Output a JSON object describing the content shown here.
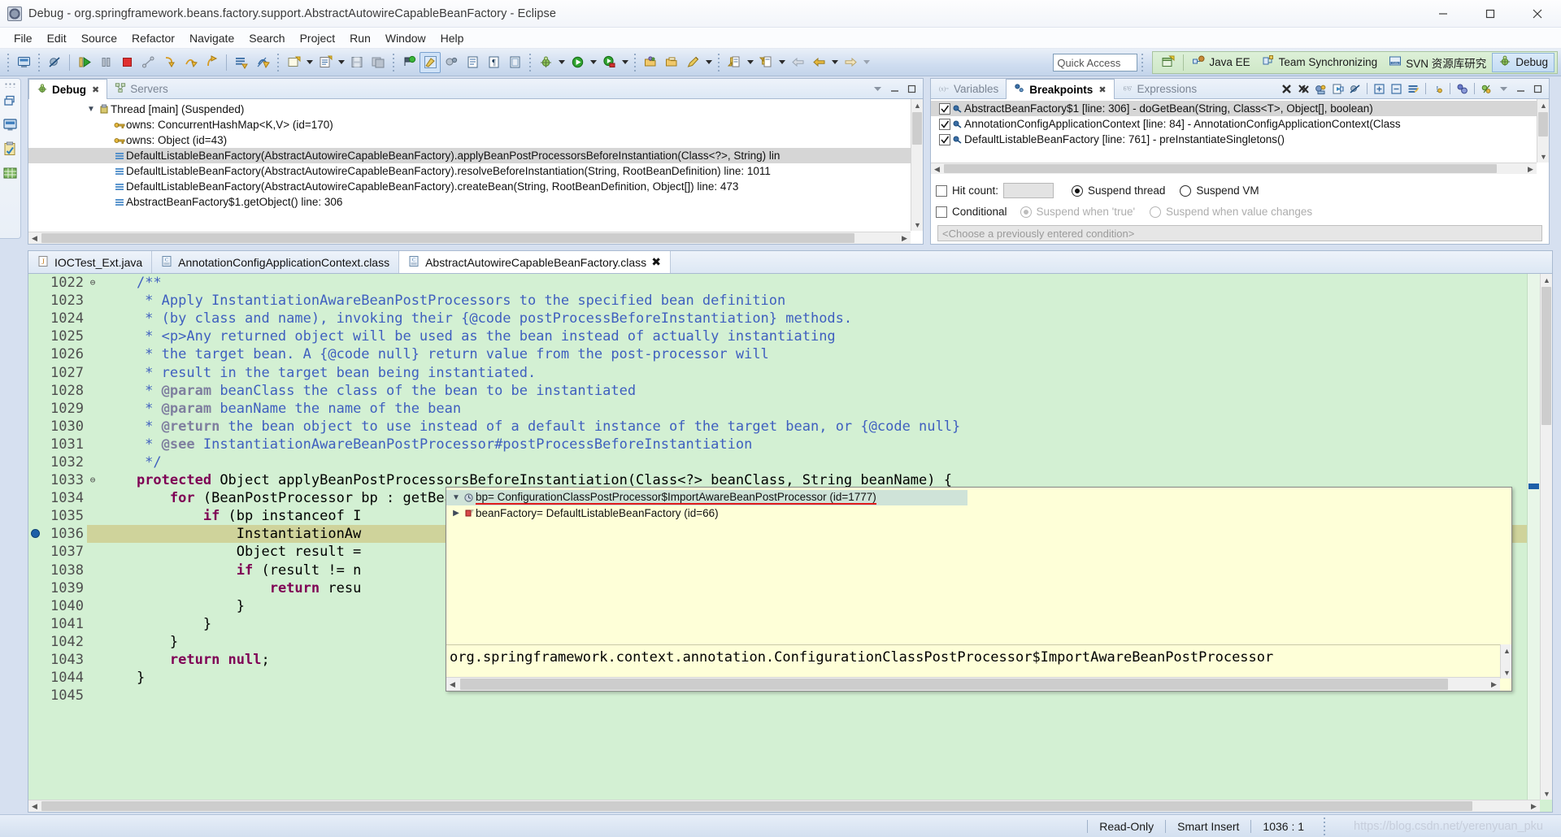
{
  "window": {
    "title": "Debug - org.springframework.beans.factory.support.AbstractAutowireCapableBeanFactory - Eclipse",
    "minimize_label": "Minimize",
    "maximize_label": "Maximize",
    "close_label": "Close"
  },
  "menubar": {
    "items": [
      "File",
      "Edit",
      "Source",
      "Refactor",
      "Navigate",
      "Search",
      "Project",
      "Run",
      "Window",
      "Help"
    ]
  },
  "toolbar": {
    "quick_access_placeholder": "Quick Access",
    "icons": [
      "new-window-icon",
      "skip-breakpoints-icon",
      "resume-icon",
      "suspend-icon",
      "terminate-icon",
      "disconnect-icon",
      "step-into-icon",
      "step-over-icon",
      "step-return-icon",
      "drop-to-frame-icon",
      "use-step-filters-icon",
      "new-wizard-icon",
      "new-java-class-icon",
      "save-icon",
      "save-all-icon",
      "debug-last-icon",
      "skip-all-breakpoints-icon",
      "toggle-mark-occurrences-icon",
      "link-with-editor-icon",
      "show-whitespace-icon",
      "show-annotations-icon",
      "debug-icon",
      "run-icon",
      "run-coverage-icon",
      "open-type-icon",
      "open-task-icon",
      "pencil-icon",
      "previous-annotation-icon",
      "next-annotation-icon",
      "back-icon",
      "forward-icon"
    ]
  },
  "perspectives": {
    "open_perspective_label": "Open Perspective",
    "items": [
      {
        "label": "Java EE",
        "icon": "java-ee-icon",
        "active": false
      },
      {
        "label": "Team Synchronizing",
        "icon": "team-sync-icon",
        "active": false
      },
      {
        "label": "SVN 资源库研究",
        "icon": "svn-icon",
        "active": false
      },
      {
        "label": "Debug",
        "icon": "debug-perspective-icon",
        "active": true
      }
    ]
  },
  "rail": {
    "items": [
      "restore-icon",
      "debug-view-icon",
      "breakpoints-view-icon",
      "variables-grid-icon"
    ]
  },
  "debug_view": {
    "tabs": [
      {
        "label": "Debug",
        "icon": "bug-icon",
        "active": true,
        "closeable": true
      },
      {
        "label": "Servers",
        "icon": "servers-icon",
        "active": false,
        "closeable": false
      }
    ],
    "tree": [
      {
        "indent": 1,
        "twisty": "v",
        "icon": "thread-icon",
        "label": "Thread [main] (Suspended)",
        "selected": false
      },
      {
        "indent": 2,
        "twisty": "",
        "icon": "monitor-key-icon",
        "label": "owns: ConcurrentHashMap<K,V>  (id=170)",
        "selected": false
      },
      {
        "indent": 2,
        "twisty": "",
        "icon": "monitor-key-icon",
        "label": "owns: Object  (id=43)",
        "selected": false
      },
      {
        "indent": 2,
        "twisty": "",
        "icon": "stack-frame-icon",
        "label": "DefaultListableBeanFactory(AbstractAutowireCapableBeanFactory).applyBeanPostProcessorsBeforeInstantiation(Class<?>, String) lin",
        "selected": true
      },
      {
        "indent": 2,
        "twisty": "",
        "icon": "stack-frame-icon",
        "label": "DefaultListableBeanFactory(AbstractAutowireCapableBeanFactory).resolveBeforeInstantiation(String, RootBeanDefinition) line: 1011",
        "selected": false
      },
      {
        "indent": 2,
        "twisty": "",
        "icon": "stack-frame-icon",
        "label": "DefaultListableBeanFactory(AbstractAutowireCapableBeanFactory).createBean(String, RootBeanDefinition, Object[]) line: 473",
        "selected": false
      },
      {
        "indent": 2,
        "twisty": "",
        "icon": "stack-frame-icon",
        "label": "AbstractBeanFactory$1.getObject() line: 306",
        "selected": false
      }
    ]
  },
  "breakpoints_view": {
    "tabs": [
      {
        "label": "Variables",
        "icon": "variables-icon",
        "active": false,
        "closeable": false
      },
      {
        "label": "Breakpoints",
        "icon": "breakpoints-icon",
        "active": true,
        "closeable": true
      },
      {
        "label": "Expressions",
        "icon": "expressions-icon",
        "active": false,
        "closeable": false
      }
    ],
    "toolbar_icons": [
      "remove-breakpoint-icon",
      "remove-all-breakpoints-icon",
      "link-with-debug-view-icon",
      "goto-file-icon",
      "skip-all-breakpoints-icon",
      "expand-all-icon",
      "collapse-all-icon",
      "working-sets-icon",
      "hit-count-icon",
      "group-by-icon",
      "add-java-exception-icon",
      "view-menu-icon",
      "minimize-icon",
      "maximize-icon"
    ],
    "rows": [
      {
        "checked": true,
        "label": "AbstractBeanFactory$1 [line: 306] - doGetBean(String, Class<T>, Object[], boolean)",
        "selected": true
      },
      {
        "checked": true,
        "label": "AnnotationConfigApplicationContext [line: 84] - AnnotationConfigApplicationContext(Class",
        "selected": false
      },
      {
        "checked": true,
        "label": "DefaultListableBeanFactory [line: 761] - preInstantiateSingletons()",
        "selected": false
      }
    ],
    "properties": {
      "hit_count_label": "Hit count:",
      "hit_count_value": "",
      "suspend_thread_label": "Suspend thread",
      "suspend_vm_label": "Suspend VM",
      "suspend_thread_selected": true,
      "conditional_label": "Conditional",
      "suspend_when_true_label": "Suspend when 'true'",
      "suspend_when_changes_label": "Suspend when value changes",
      "condition_combo_text": "<Choose a previously entered condition>"
    }
  },
  "editor": {
    "tabs": [
      {
        "label": "IOCTest_Ext.java",
        "icon": "java-file-icon",
        "active": false,
        "closeable": false
      },
      {
        "label": "AnnotationConfigApplicationContext.class",
        "icon": "class-file-icon",
        "active": false,
        "closeable": false
      },
      {
        "label": "AbstractAutowireCapableBeanFactory.class",
        "icon": "class-file-icon",
        "active": true,
        "closeable": true
      }
    ],
    "lines": [
      {
        "num": "1022",
        "fold": "⊖",
        "bp": false,
        "hl": false,
        "segs": [
          {
            "t": "    ",
            "c": "plain"
          },
          {
            "t": "/**",
            "c": "cm"
          }
        ]
      },
      {
        "num": "1023",
        "fold": "",
        "bp": false,
        "hl": false,
        "segs": [
          {
            "t": "     * Apply InstantiationAwareBeanPostProcessors to the specified bean definition",
            "c": "cm"
          }
        ]
      },
      {
        "num": "1024",
        "fold": "",
        "bp": false,
        "hl": false,
        "segs": [
          {
            "t": "     * (by class and name), invoking their {@code postProcessBeforeInstantiation} methods.",
            "c": "cm"
          }
        ]
      },
      {
        "num": "1025",
        "fold": "",
        "bp": false,
        "hl": false,
        "segs": [
          {
            "t": "     * <p>Any returned object will be used as the bean instead of actually instantiating",
            "c": "cm"
          }
        ]
      },
      {
        "num": "1026",
        "fold": "",
        "bp": false,
        "hl": false,
        "segs": [
          {
            "t": "     * the target bean. A {@code null} return value from the post-processor will",
            "c": "cm"
          }
        ]
      },
      {
        "num": "1027",
        "fold": "",
        "bp": false,
        "hl": false,
        "segs": [
          {
            "t": "     * result in the target bean being instantiated.",
            "c": "cm"
          }
        ]
      },
      {
        "num": "1028",
        "fold": "",
        "bp": false,
        "hl": false,
        "segs": [
          {
            "t": "     * ",
            "c": "cm"
          },
          {
            "t": "@param",
            "c": "cmtag"
          },
          {
            "t": " beanClass the class of the bean to be instantiated",
            "c": "cm"
          }
        ]
      },
      {
        "num": "1029",
        "fold": "",
        "bp": false,
        "hl": false,
        "segs": [
          {
            "t": "     * ",
            "c": "cm"
          },
          {
            "t": "@param",
            "c": "cmtag"
          },
          {
            "t": " beanName the name of the bean",
            "c": "cm"
          }
        ]
      },
      {
        "num": "1030",
        "fold": "",
        "bp": false,
        "hl": false,
        "segs": [
          {
            "t": "     * ",
            "c": "cm"
          },
          {
            "t": "@return",
            "c": "cmtag"
          },
          {
            "t": " the bean object to use instead of a default instance of the target bean, or {@code null}",
            "c": "cm"
          }
        ]
      },
      {
        "num": "1031",
        "fold": "",
        "bp": false,
        "hl": false,
        "segs": [
          {
            "t": "     * ",
            "c": "cm"
          },
          {
            "t": "@see",
            "c": "cmtag"
          },
          {
            "t": " InstantiationAwareBeanPostProcessor#postProcessBeforeInstantiation",
            "c": "cm"
          }
        ]
      },
      {
        "num": "1032",
        "fold": "",
        "bp": false,
        "hl": false,
        "segs": [
          {
            "t": "     */",
            "c": "cm"
          }
        ]
      },
      {
        "num": "1033",
        "fold": "⊖",
        "bp": false,
        "hl": false,
        "segs": [
          {
            "t": "    ",
            "c": "plain"
          },
          {
            "t": "protected",
            "c": "kw"
          },
          {
            "t": " Object applyBeanPostProcessorsBeforeInstantiation(Class<?> beanClass, String beanName) {",
            "c": "plain"
          }
        ]
      },
      {
        "num": "1034",
        "fold": "",
        "bp": false,
        "hl": false,
        "segs": [
          {
            "t": "        ",
            "c": "plain"
          },
          {
            "t": "for",
            "c": "kw"
          },
          {
            "t": " (BeanPostProcessor bp : getBeanPostProcessors()) {",
            "c": "plain"
          }
        ]
      },
      {
        "num": "1035",
        "fold": "",
        "bp": false,
        "hl": false,
        "segs": [
          {
            "t": "            ",
            "c": "plain"
          },
          {
            "t": "if",
            "c": "kw"
          },
          {
            "t": " (bp instanceof I",
            "c": "plain"
          }
        ]
      },
      {
        "num": "1036",
        "fold": "",
        "bp": true,
        "hl": true,
        "segs": [
          {
            "t": "                InstantiationAw",
            "c": "plain"
          }
        ]
      },
      {
        "num": "1037",
        "fold": "",
        "bp": false,
        "hl": false,
        "segs": [
          {
            "t": "                Object result =",
            "c": "plain"
          }
        ]
      },
      {
        "num": "1038",
        "fold": "",
        "bp": false,
        "hl": false,
        "segs": [
          {
            "t": "                ",
            "c": "plain"
          },
          {
            "t": "if",
            "c": "kw"
          },
          {
            "t": " (result != n",
            "c": "plain"
          }
        ]
      },
      {
        "num": "1039",
        "fold": "",
        "bp": false,
        "hl": false,
        "segs": [
          {
            "t": "                    ",
            "c": "plain"
          },
          {
            "t": "return",
            "c": "kw"
          },
          {
            "t": " resu",
            "c": "plain"
          }
        ]
      },
      {
        "num": "1040",
        "fold": "",
        "bp": false,
        "hl": false,
        "segs": [
          {
            "t": "                }",
            "c": "plain"
          }
        ]
      },
      {
        "num": "1041",
        "fold": "",
        "bp": false,
        "hl": false,
        "segs": [
          {
            "t": "            }",
            "c": "plain"
          }
        ]
      },
      {
        "num": "1042",
        "fold": "",
        "bp": false,
        "hl": false,
        "segs": [
          {
            "t": "        }",
            "c": "plain"
          }
        ]
      },
      {
        "num": "1043",
        "fold": "",
        "bp": false,
        "hl": false,
        "segs": [
          {
            "t": "        ",
            "c": "plain"
          },
          {
            "t": "return null",
            "c": "kw"
          },
          {
            "t": ";",
            "c": "plain"
          }
        ]
      },
      {
        "num": "1044",
        "fold": "",
        "bp": false,
        "hl": false,
        "segs": [
          {
            "t": "    }",
            "c": "plain"
          }
        ]
      },
      {
        "num": "1045",
        "fold": "",
        "bp": false,
        "hl": false,
        "segs": [
          {
            "t": "",
            "c": "plain"
          }
        ]
      }
    ]
  },
  "popup": {
    "rows": [
      {
        "twisty": "v",
        "icon": "local-variable-icon",
        "label": "bp= ConfigurationClassPostProcessor$ImportAwareBeanPostProcessor  (id=1777)",
        "selected": true,
        "underlined": true
      },
      {
        "twisty": ">",
        "icon": "field-variable-icon",
        "label": "beanFactory= DefaultListableBeanFactory  (id=66)",
        "selected": false,
        "underlined": false
      }
    ],
    "detail": "org.springframework.context.annotation.ConfigurationClassPostProcessor$ImportAwareBeanPostProcessor"
  },
  "statusbar": {
    "read_only": "Read-Only",
    "insert_mode": "Smart Insert",
    "cursor_position": "1036 : 1",
    "watermark": "https://blog.csdn.net/yerenyuan_pku"
  },
  "colors": {
    "editor_bg": "#d3f0d3",
    "highlight_line": "#cfd39b",
    "popup_bg": "#feffd8",
    "accent_red": "#e01b1b",
    "keyword": "#7f0055",
    "comment": "#3f5fbf"
  }
}
